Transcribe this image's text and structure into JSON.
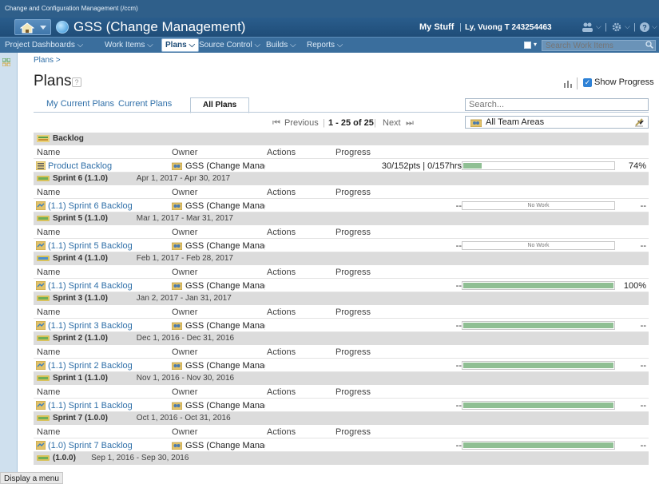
{
  "window": {
    "title": "Change and Configuration Management (/ccm)"
  },
  "header": {
    "project": "GSS (Change Management)",
    "my_stuff": "My Stuff",
    "user": "Ly, Vuong T 243254463"
  },
  "nav": {
    "items": [
      "Project Dashboards",
      "Work Items",
      "Plans",
      "Source Control",
      "Builds",
      "Reports"
    ],
    "active": "Plans",
    "search_placeholder": "Search Work Items"
  },
  "breadcrumb": "Plans >",
  "page": {
    "title": "Plans",
    "help": "?",
    "show_progress_label": "Show Progress",
    "show_progress_checked": true
  },
  "tabs": [
    "My Current Plans",
    "Current Plans",
    "All Plans"
  ],
  "active_tab": "All Plans",
  "search": {
    "placeholder": "Search..."
  },
  "pager": {
    "first": "⏮",
    "previous": "Previous",
    "range": "1 - 25 of 25",
    "next": "Next",
    "last": "⏭"
  },
  "team_filter": {
    "selected": "All Team Areas"
  },
  "columns": {
    "name": "Name",
    "owner": "Owner",
    "actions": "Actions",
    "progress": "Progress"
  },
  "sections": [
    {
      "name": "Backlog",
      "dates": "",
      "icon": "backlog-icon",
      "plans": [
        {
          "name": "Product Backlog",
          "owner": "GSS (Change Manag",
          "progress_text": "30/152pts | 0/157hrs",
          "fill": 0.12,
          "pct": "74%",
          "no_work": ""
        }
      ]
    },
    {
      "name": "Sprint 6 (1.1.0)",
      "dates": "Apr 1, 2017 - Apr 30, 2017",
      "icon": "iteration-icon",
      "plans": [
        {
          "name": "(1.1) Sprint 6 Backlog",
          "owner": "GSS (Change Manag",
          "progress_text": "--",
          "fill": 0,
          "pct": "--",
          "no_work": "No Work"
        }
      ]
    },
    {
      "name": "Sprint 5 (1.1.0)",
      "dates": "Mar 1, 2017 - Mar 31, 2017",
      "icon": "iteration-icon",
      "plans": [
        {
          "name": "(1.1) Sprint 5 Backlog",
          "owner": "GSS (Change Manag",
          "progress_text": "--",
          "fill": 0,
          "pct": "--",
          "no_work": "No Work"
        }
      ]
    },
    {
      "name": "Sprint 4 (1.1.0)",
      "dates": "Feb 1, 2017 - Feb 28, 2017",
      "icon": "current-iteration-icon",
      "plans": [
        {
          "name": "(1.1) Sprint 4 Backlog",
          "owner": "GSS (Change Manag",
          "progress_text": "--",
          "fill": 1,
          "pct": "100%",
          "no_work": ""
        }
      ]
    },
    {
      "name": "Sprint 3 (1.1.0)",
      "dates": "Jan 2, 2017 - Jan 31, 2017",
      "icon": "iteration-icon",
      "plans": [
        {
          "name": "(1.1) Sprint 3 Backlog",
          "owner": "GSS (Change Manag",
          "progress_text": "--",
          "fill": 1,
          "pct": "--",
          "no_work": ""
        }
      ]
    },
    {
      "name": "Sprint 2 (1.1.0)",
      "dates": "Dec 1, 2016 - Dec 31, 2016",
      "icon": "iteration-icon",
      "plans": [
        {
          "name": "(1.1) Sprint 2 Backlog",
          "owner": "GSS (Change Manag",
          "progress_text": "--",
          "fill": 1,
          "pct": "--",
          "no_work": ""
        }
      ]
    },
    {
      "name": "Sprint 1 (1.1.0)",
      "dates": "Nov 1, 2016 - Nov 30, 2016",
      "icon": "iteration-icon",
      "plans": [
        {
          "name": "(1.1) Sprint 1 Backlog",
          "owner": "GSS (Change Manag",
          "progress_text": "--",
          "fill": 1,
          "pct": "--",
          "no_work": ""
        }
      ]
    },
    {
      "name": "Sprint 7 (1.0.0)",
      "dates": "Oct 1, 2016 - Oct 31, 2016",
      "icon": "iteration-icon",
      "plans": [
        {
          "name": "(1.0) Sprint 7 Backlog",
          "owner": "GSS (Change Manag",
          "progress_text": "--",
          "fill": 1,
          "pct": "--",
          "no_work": ""
        }
      ]
    },
    {
      "name": "(1.0.0)",
      "dates": "Sep 1, 2016 - Sep 30, 2016",
      "icon": "iteration-icon",
      "plans": []
    }
  ],
  "status_bar": "Display a menu",
  "colors": {
    "header": "#2a5d8c",
    "nav": "#3a6e9d",
    "link": "#2f6fa8",
    "progress_fill": "#8fbf93",
    "section_bg": "#dcdcdc"
  }
}
